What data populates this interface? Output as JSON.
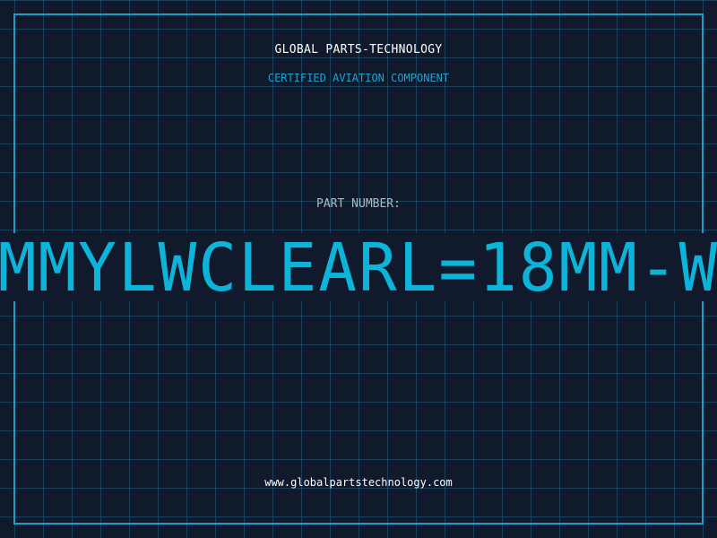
{
  "company_name": "GLOBAL PARTS-TECHNOLOGY",
  "subtitle": "CERTIFIED AVIATION COMPONENT",
  "part_number_label": "PART NUMBER:",
  "part_number_value": "MMYLWCLEARL=18MM-W",
  "website": "www.globalpartstechnology.com",
  "colors": {
    "background": "#101a2c",
    "grid": "#1e6082",
    "frame": "#1a9fca",
    "accent": "#0cb4d9",
    "label": "#aeb9c6",
    "text": "#ffffff"
  }
}
